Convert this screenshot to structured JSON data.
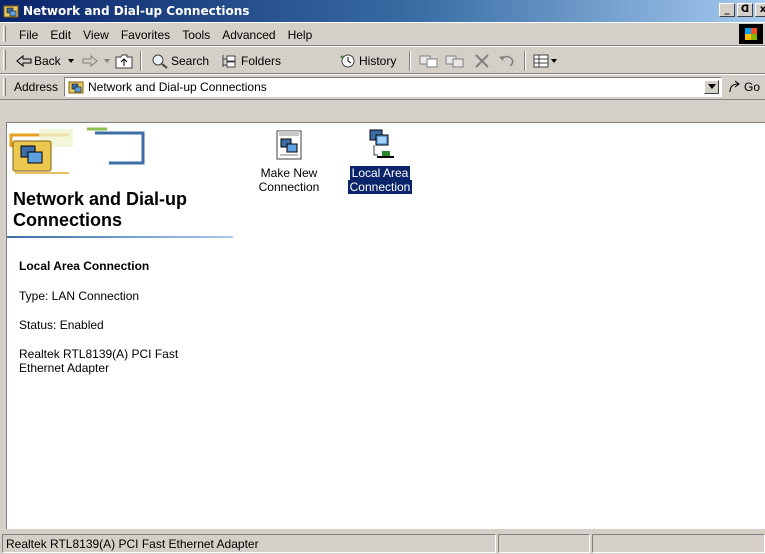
{
  "window": {
    "title": "Network and Dial-up Connections",
    "min_glyph": "_",
    "max_glyph": "ᗡ",
    "close_glyph": "x"
  },
  "menu": {
    "file": "File",
    "edit": "Edit",
    "view": "View",
    "favorites": "Favorites",
    "tools": "Tools",
    "advanced": "Advanced",
    "help": "Help"
  },
  "toolbar": {
    "back": "Back",
    "search": "Search",
    "folders": "Folders",
    "history": "History"
  },
  "address": {
    "label": "Address",
    "value": "Network and Dial-up Connections",
    "go": "Go"
  },
  "left_pane": {
    "title": "Network and Dial-up Connections",
    "selected_name": "Local Area Connection",
    "type": "Type: LAN Connection",
    "status": "Status: Enabled",
    "adapter": "Realtek RTL8139(A) PCI Fast Ethernet Adapter"
  },
  "items": [
    {
      "line1": "Make New",
      "line2": "Connection",
      "icon": "make-new-connection-icon"
    },
    {
      "line1": "Local Area",
      "line2": "Connection",
      "icon": "lan-connection-icon",
      "selected": true
    }
  ],
  "status_bar": {
    "text": "Realtek RTL8139(A) PCI Fast Ethernet Adapter"
  },
  "colors": {
    "title_dark": "#0a246a",
    "title_light": "#a6caf0",
    "selection": "#0a246a",
    "chrome": "#d4d0c8"
  }
}
